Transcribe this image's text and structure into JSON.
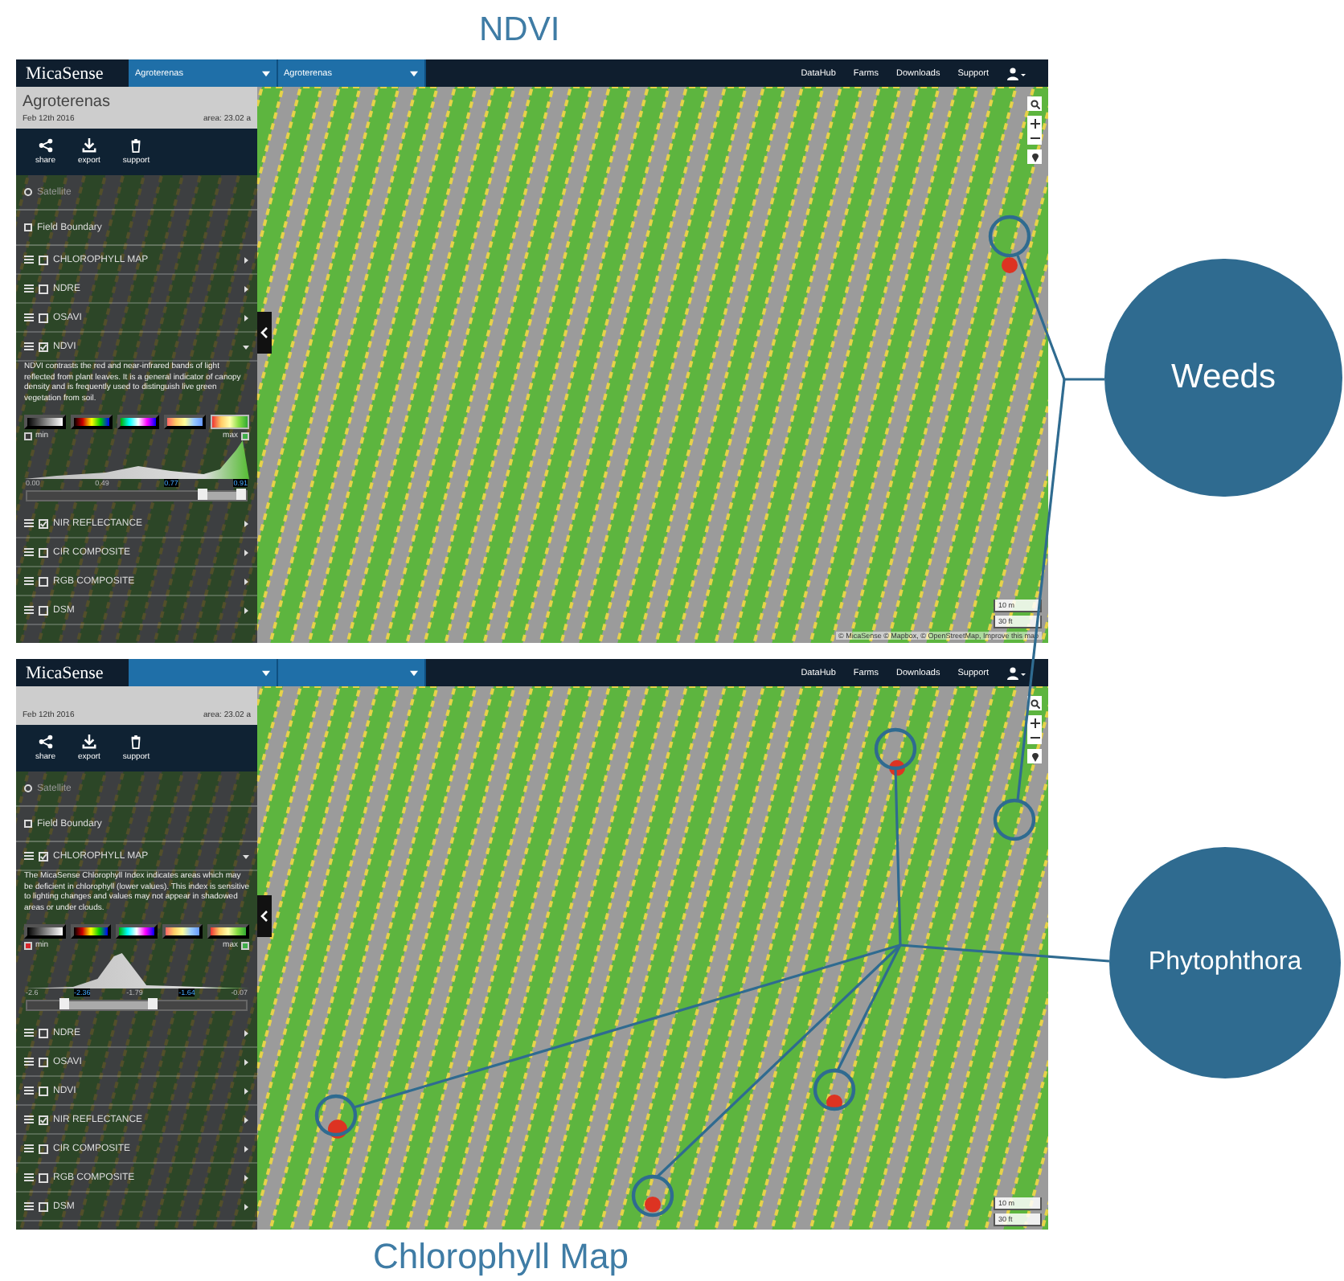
{
  "title": "NDVI",
  "panels": [
    {
      "topbar": {
        "logo": "MicaSense",
        "dropdowns": [
          {
            "label": "Agroterenas"
          },
          {
            "label": "Agroterenas"
          }
        ],
        "nav": [
          "DataHub",
          "Farms",
          "Downloads",
          "Support"
        ]
      },
      "sidebar": {
        "farm_name": "Agroterenas",
        "date": "Feb 12th 2016",
        "area": "area: 23.02 a",
        "tools": [
          {
            "kind": "share",
            "label": "share"
          },
          {
            "kind": "export",
            "label": "export"
          },
          {
            "kind": "support",
            "label": "support"
          }
        ],
        "base_layers": [
          {
            "kind": "radio",
            "label": "Satellite",
            "checked": false
          },
          {
            "kind": "checkbox",
            "label": "Field Boundary",
            "checked": false
          }
        ],
        "layers": [
          {
            "label": "CHLOROPHYLL MAP",
            "checked": false,
            "expanded": false
          },
          {
            "label": "NDRE",
            "checked": false,
            "expanded": false
          },
          {
            "label": "OSAVI",
            "checked": false,
            "expanded": false
          },
          {
            "label": "NDVI",
            "checked": true,
            "expanded": true,
            "description": "NDVI contrasts the red and near-infrared bands of light reflected from plant leaves. It is a general indicator of canopy density and is frequently used to distinguish live green vegetation from soil.",
            "legend": {
              "palettes": [
                {
                  "kind": "gray",
                  "selected": false
                },
                {
                  "kind": "spectrum",
                  "selected": false
                },
                {
                  "kind": "rainbow",
                  "selected": false
                },
                {
                  "kind": "pastel",
                  "selected": false
                },
                {
                  "kind": "redgreen",
                  "selected": true
                }
              ],
              "min": {
                "label": "min",
                "color": "#3a3a3a"
              },
              "max": {
                "label": "max",
                "color": "#3fae49"
              },
              "ticks": [
                {
                  "label": "0.00",
                  "highlighted": false
                },
                {
                  "label": "0.49",
                  "highlighted": false
                },
                {
                  "label": "0.77",
                  "highlighted": true
                },
                {
                  "label": "0.91",
                  "highlighted": true
                }
              ],
              "thumbs": [
                {
                  "level": 0.8
                },
                {
                  "level": 0.98
                }
              ]
            }
          },
          {
            "label": "NIR REFLECTANCE",
            "checked": true,
            "expanded": false
          },
          {
            "label": "CIR COMPOSITE",
            "checked": false,
            "expanded": false
          },
          {
            "label": "RGB COMPOSITE",
            "checked": false,
            "expanded": false
          },
          {
            "label": "DSM",
            "checked": false,
            "expanded": false
          }
        ]
      },
      "map": {
        "scale": [
          "10 m",
          "30 ft"
        ],
        "attribution": "© MicaSense  © Mapbox, © OpenStreetMap, Improve this map"
      }
    },
    {
      "topbar": {
        "logo": "MicaSense",
        "nav": [
          "DataHub",
          "Farms",
          "Downloads",
          "Support"
        ]
      },
      "sidebar": {
        "date": "Feb 12th 2016",
        "area": "area: 23.02 a",
        "tools": [
          {
            "kind": "share",
            "label": "share"
          },
          {
            "kind": "export",
            "label": "export"
          },
          {
            "kind": "support",
            "label": "support"
          }
        ],
        "base_layers": [
          {
            "kind": "radio",
            "label": "Satellite",
            "checked": false
          },
          {
            "kind": "checkbox",
            "label": "Field Boundary",
            "checked": false
          }
        ],
        "layers": [
          {
            "label": "CHLOROPHYLL MAP",
            "checked": true,
            "expanded": true,
            "description": "The MicaSense Chlorophyll Index indicates areas which may be deficient in chlorophyll (lower values). This index is sensitive to lighting changes and values may not appear in shadowed areas or under clouds.",
            "legend": {
              "palettes": [
                {
                  "kind": "gray",
                  "selected": false
                },
                {
                  "kind": "spectrum",
                  "selected": false
                },
                {
                  "kind": "rainbow",
                  "selected": false
                },
                {
                  "kind": "pastel",
                  "selected": false
                },
                {
                  "kind": "redgreen",
                  "selected": false
                }
              ],
              "min": {
                "label": "min",
                "color": "#d9262c"
              },
              "max": {
                "label": "max",
                "color": "#3fae49"
              },
              "ticks": [
                {
                  "label": "-2.6",
                  "highlighted": false
                },
                {
                  "label": "-2.36",
                  "highlighted": true
                },
                {
                  "label": "-1.79",
                  "highlighted": false
                },
                {
                  "label": "-1.64",
                  "highlighted": true
                },
                {
                  "label": "-0.07",
                  "highlighted": false
                }
              ],
              "thumbs": [
                {
                  "level": 0.17
                },
                {
                  "level": 0.57
                }
              ]
            }
          },
          {
            "label": "NDRE",
            "checked": false,
            "expanded": false
          },
          {
            "label": "OSAVI",
            "checked": false,
            "expanded": false
          },
          {
            "label": "NDVI",
            "checked": false,
            "expanded": false
          },
          {
            "label": "NIR REFLECTANCE",
            "checked": true,
            "expanded": false
          },
          {
            "label": "CIR COMPOSITE",
            "checked": false,
            "expanded": false
          },
          {
            "label": "RGB COMPOSITE",
            "checked": false,
            "expanded": false
          },
          {
            "label": "DSM",
            "checked": false,
            "expanded": false
          }
        ]
      },
      "map": {
        "scale": [
          "10 m",
          "30 ft"
        ]
      }
    }
  ],
  "callouts": [
    {
      "label": "Weeds"
    },
    {
      "label": "Phytophthora"
    }
  ],
  "caption": "Chlorophyll Map"
}
